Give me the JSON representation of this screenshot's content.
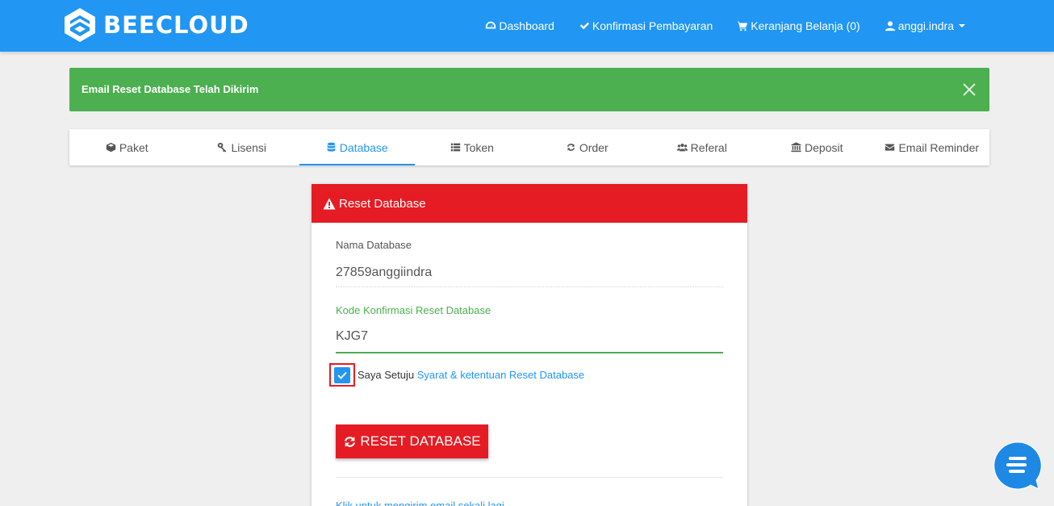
{
  "brand": {
    "name": "BEECLOUD"
  },
  "nav": {
    "dashboard": "Dashboard",
    "konfirmasi": "Konfirmasi Pembayaran",
    "keranjang": "Keranjang Belanja (0)",
    "user": "anggi.indra"
  },
  "alert": {
    "message": "Email Reset Database Telah Dikirim"
  },
  "tabs": {
    "paket": "Paket",
    "lisensi": "Lisensi",
    "database": "Database",
    "token": "Token",
    "order": "Order",
    "referal": "Referal",
    "deposit": "Deposit",
    "email_reminder": "Email Reminder"
  },
  "card": {
    "title": "Reset Database",
    "db_label": "Nama Database",
    "db_value": "27859anggiindra",
    "code_label": "Kode Konfirmasi Reset Database",
    "code_value": "KJG7",
    "agree_text": "Saya Setuju",
    "agree_link": "Syarat & ketentuan Reset Database",
    "button": "RESET DATABASE",
    "resend": "Klik untuk mengirim email sekali lagi"
  },
  "colors": {
    "primary": "#2196f3",
    "success": "#4caf50",
    "danger": "#e51c23"
  }
}
